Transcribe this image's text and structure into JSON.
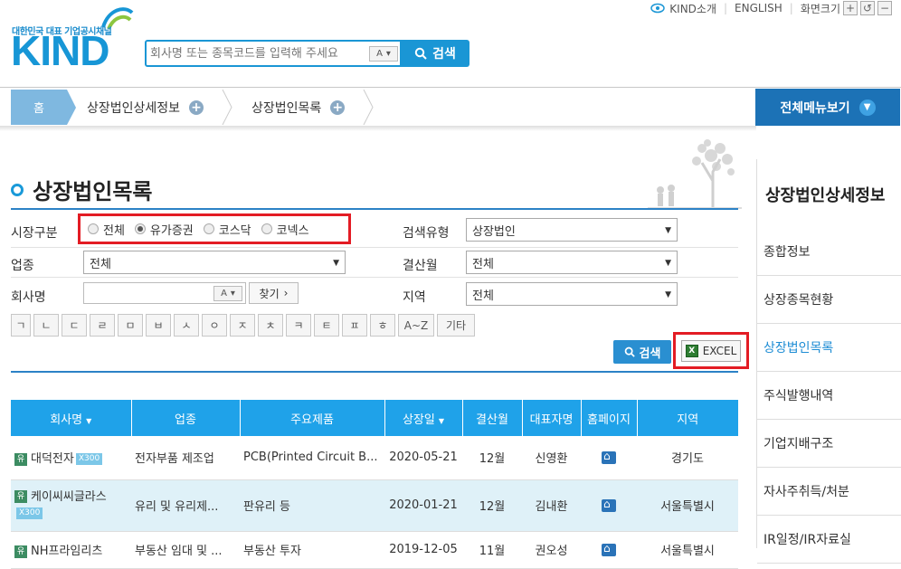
{
  "header": {
    "logo_tagline": "대한민국 대표 기업공시채널",
    "logo_text": "KIND",
    "search_placeholder": "회사명 또는 종목코드를 입력해 주세요",
    "search_a_label": "A",
    "search_button": "검색",
    "toplinks": {
      "about": "KIND소개",
      "english": "ENGLISH",
      "screen_size": "화면크기"
    },
    "size_buttons": [
      "+",
      "↺",
      "−"
    ]
  },
  "breadcrumb": {
    "home": "홈",
    "items": [
      "상장법인상세정보",
      "상장법인목록"
    ],
    "all_menu": "전체메뉴보기"
  },
  "page": {
    "title": "상장법인목록"
  },
  "form": {
    "market_label": "시장구분",
    "market_options": [
      {
        "label": "전체",
        "checked": false
      },
      {
        "label": "유가증권",
        "checked": true
      },
      {
        "label": "코스닥",
        "checked": false
      },
      {
        "label": "코넥스",
        "checked": false
      }
    ],
    "search_type_label": "검색유형",
    "search_type_value": "상장법인",
    "industry_label": "업종",
    "industry_value": "전체",
    "fiscal_label": "결산월",
    "fiscal_value": "전체",
    "company_label": "회사명",
    "company_a_label": "A",
    "find_button": "찾기",
    "region_label": "지역",
    "region_value": "전체",
    "initials": [
      "ㄱ",
      "ㄴ",
      "ㄷ",
      "ㄹ",
      "ㅁ",
      "ㅂ",
      "ㅅ",
      "ㅇ",
      "ㅈ",
      "ㅊ",
      "ㅋ",
      "ㅌ",
      "ㅍ",
      "ㅎ",
      "A~Z",
      "기타"
    ],
    "search_button": "검색",
    "excel_button": "EXCEL"
  },
  "table": {
    "headers": [
      "회사명",
      "업종",
      "주요제품",
      "상장일",
      "결산월",
      "대표자명",
      "홈페이지",
      "지역"
    ],
    "rows": [
      {
        "badge": "유",
        "name": "대덕전자",
        "tag": "X300",
        "industry": "전자부품 제조업",
        "product": "PCB(Printed Circuit B...",
        "date": "2020-05-21",
        "month": "12월",
        "ceo": "신영환",
        "region": "경기도"
      },
      {
        "badge": "유",
        "name": "케이씨씨글라스",
        "tag": "X300",
        "industry": "유리 및 유리제...",
        "product": "판유리 등",
        "date": "2020-01-21",
        "month": "12월",
        "ceo": "김내환",
        "region": "서울특별시"
      },
      {
        "badge": "유",
        "name": "NH프라임리츠",
        "tag": "",
        "industry": "부동산 임대 및 ...",
        "product": "부동산 투자",
        "date": "2019-12-05",
        "month": "11월",
        "ceo": "권오성",
        "region": "서울특별시"
      }
    ]
  },
  "sidebar": {
    "title": "상장법인상세정보",
    "items": [
      {
        "label": "종합정보",
        "active": false
      },
      {
        "label": "상장종목현황",
        "active": false
      },
      {
        "label": "상장법인목록",
        "active": true
      },
      {
        "label": "주식발행내역",
        "active": false
      },
      {
        "label": "기업지배구조",
        "active": false
      },
      {
        "label": "자사주취득/처분",
        "active": false
      },
      {
        "label": "IR일정/IR자료실",
        "active": false
      }
    ]
  },
  "colors": {
    "brand_blue": "#1a96d5",
    "header_blue": "#1fa2e9",
    "highlight_red": "#e31c24",
    "active_link": "#1d8cd4"
  }
}
